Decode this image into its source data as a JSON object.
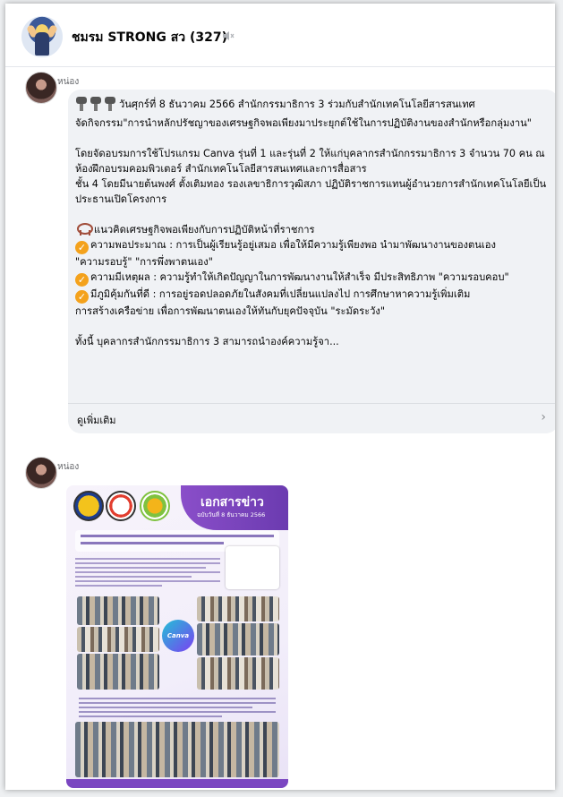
{
  "chat": {
    "title": "ชมรม STRONG สว (327)",
    "mute_icon": "speaker-muted-icon"
  },
  "messages": [
    {
      "sender": "หน่อง",
      "paragraphs": {
        "p1": "วันศุกร์ที่ 8 ธันวาคม 2566 สำนักกรรมาธิการ 3 ร่วมกับสำนักเทคโนโลยีสารสนเทศ",
        "p2": "จัดกิจกรรม\"การนำหลักปรัชญาของเศรษฐกิจพอเพียงมาประยุกต์ใช้ในการปฏิบัติงานของสำนักหรือกลุ่มงาน\"",
        "p3": "โดยจัดอบรมการใช้โปรแกรม Canva รุ่นที่ 1 และรุ่นที่ 2 ให้แก่บุคลากรสำนักกรรมาธิการ 3 จำนวน 70 คน ณ ห้องฝึกอบรมคอมพิวเตอร์ สำนักเทคโนโลยีสารสนเทศและการสื่อสาร",
        "p4": "ชั้น 4 โดยมีนายต้นพงศ์ ตั้งเติมทอง รองเลขาธิการวุฒิสภา ปฏิบัติราชการแทนผู้อำนวยการสำนักเทคโนโลยีเป็นประธานเปิดโครงการ",
        "p5": "แนวคิดเศรษฐกิจพอเพียงกับการปฏิบัติหน้าที่ราชการ",
        "p6": "ความพอประมาณ : การเป็นผู้เรียนรู้อยู่เสมอ เพื่อให้มีความรู้เพียงพอ นำมาพัฒนางานของตนเอง",
        "p7": "\"ความรอบรู้\" \"การพึ่งพาตนเอง\"",
        "p8": "ความมีเหตุผล : ความรู้ทำให้เกิดปัญญาในการพัฒนางานให้สำเร็จ มีประสิทธิภาพ \"ความรอบคอบ\"",
        "p9": "มีภูมิคุ้มกันที่ดี : การอยู่รอดปลอดภัยในสังคมที่เปลี่ยนแปลงไป การศึกษาหาความรู้เพิ่มเติม",
        "p10": "การสร้างเครือข่าย เพื่อการพัฒนาตนเองให้ทันกับยุคปัจจุบัน \"ระมัดระวัง\"",
        "p11": "ทั้งนี้ บุคลากรสำนักกรรมาธิการ 3 สามารถนำองค์ความรู้จา..."
      },
      "see_more": "ดูเพิ่มเติม"
    },
    {
      "sender": "หน่อง",
      "poster": {
        "title": "เอกสารข่าว",
        "date": "ฉบับวันที่ 8 ธันวาคม 2566",
        "logo_text": "Canva"
      }
    }
  ]
}
